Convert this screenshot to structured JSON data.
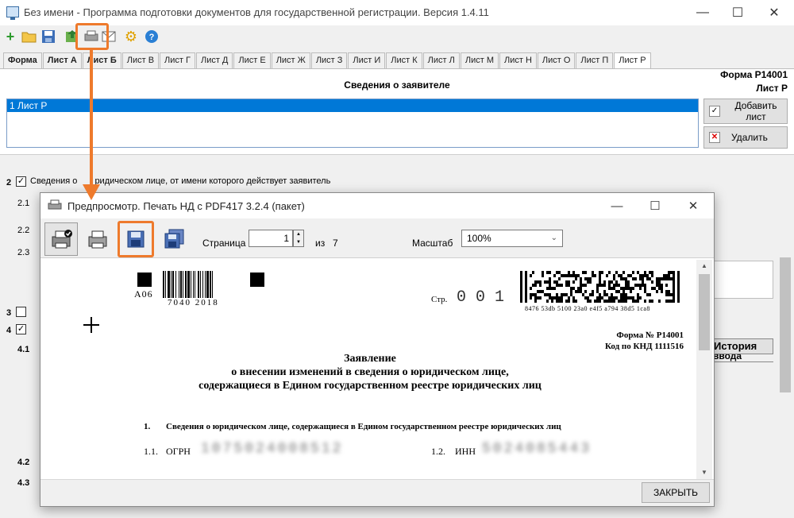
{
  "window": {
    "title": "Без имени - Программа подготовки документов для государственной регистрации. Версия 1.4.11"
  },
  "tabs": [
    "Форма",
    "Лист А",
    "Лист Б",
    "Лист В",
    "Лист Г",
    "Лист Д",
    "Лист Е",
    "Лист Ж",
    "Лист З",
    "Лист И",
    "Лист К",
    "Лист Л",
    "Лист М",
    "Лист Н",
    "Лист О",
    "Лист П",
    "Лист Р"
  ],
  "form": {
    "code_line1": "Форма Р14001",
    "code_line2": "Лист Р",
    "section_title": "Сведения о заявителе",
    "list_item": "1 Лист Р",
    "add_sheet_label": "Добавить лист",
    "delete_label": "Удалить"
  },
  "lower": {
    "row2_num": "2",
    "row2_label": "Сведения о юридическом лице, от имени которого действует заявитель",
    "row2_label_visible": "Сведения о",
    "row2_label_tail": "ридическом лице, от имени которого действует заявитель",
    "sub_21": "2.1",
    "sub_22": "2.2",
    "sub_23": "2.3",
    "row3_num": "3",
    "row4_num": "4",
    "sub_41": "4.1",
    "sub_42": "4.2",
    "sub_43": "4.3",
    "history_line1": "История",
    "history_line2": "ввода"
  },
  "dialog": {
    "title": "Предпросмотр. Печать НД с PDF417 3.2.4 (пакет)",
    "page_label": "Страница",
    "page_value": "1",
    "of_label": "из",
    "total_pages": "7",
    "zoom_label": "Масштаб",
    "zoom_value": "100%",
    "close_label": "ЗАКРЫТЬ"
  },
  "document": {
    "code_a": "А06",
    "barcode_number": "7040 2018",
    "page_label": "Стр.",
    "page_number": "0 0 1",
    "pdf417_caption": "8476 53db 5100 23a0 e4f5 a794 38d5 1ca8",
    "form_number": "Форма № Р14001",
    "knd_code": "Код по КНД 1111516",
    "heading1": "Заявление",
    "heading2": "о внесении изменений в сведения о юридическом лице,",
    "heading3": "содержащиеся в Едином государственном реестре юридических лиц",
    "section1_num": "1.",
    "section1_title": "Сведения о юридическом лице, содержащиеся в Едином государственном реестре юридических лиц",
    "field11_num": "1.1.",
    "field11_label": "ОГРН",
    "field11_value": "1075024008512",
    "field12_num": "1.2.",
    "field12_label": "ИНН",
    "field12_value": "5024085443"
  },
  "colors": {
    "highlight": "#ee7a2c",
    "selection": "#0078d7"
  },
  "icons": [
    "add-icon",
    "open-folder-icon",
    "save-icon",
    "export-icon",
    "print-preview-icon",
    "mail-icon",
    "settings-gear-icon",
    "help-icon"
  ]
}
